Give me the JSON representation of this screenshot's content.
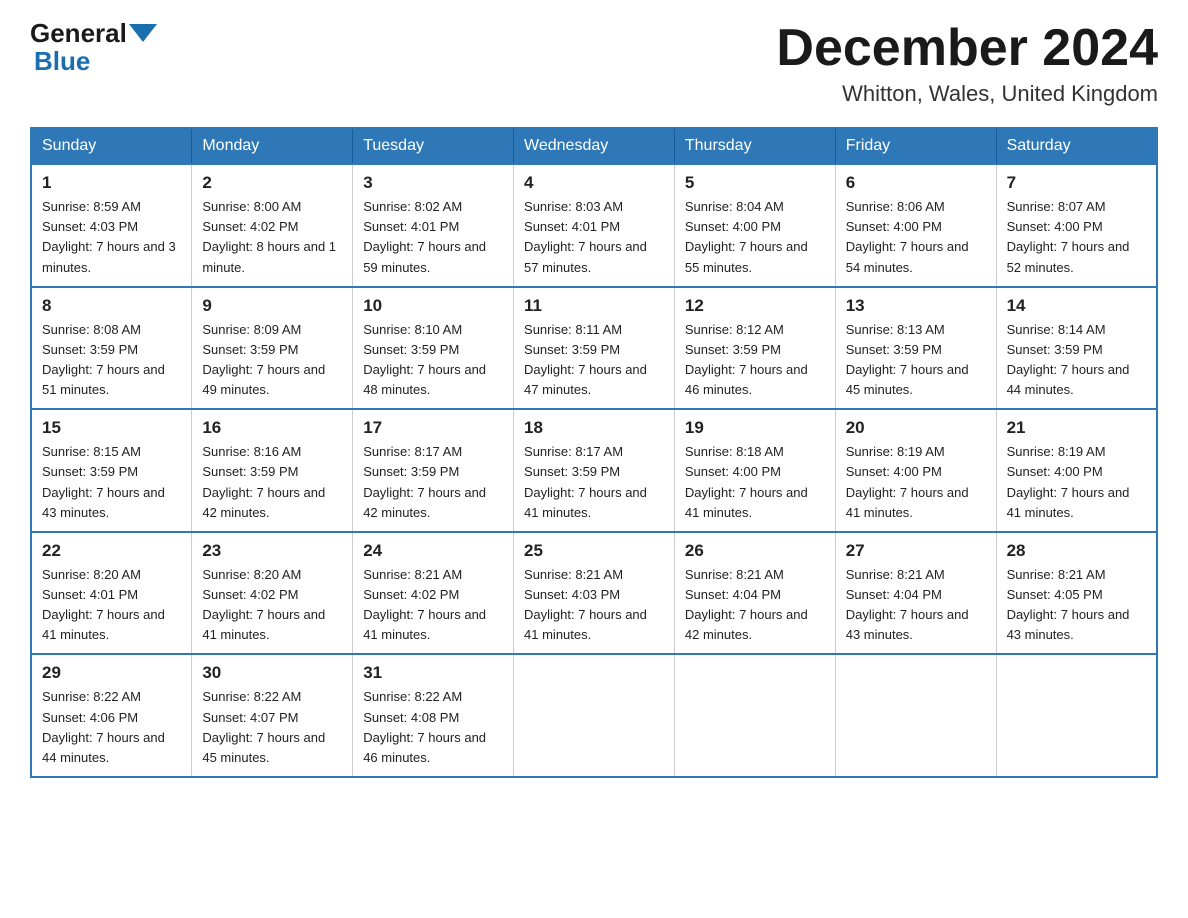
{
  "header": {
    "logo_text1": "General",
    "logo_text2": "Blue",
    "month": "December 2024",
    "location": "Whitton, Wales, United Kingdom"
  },
  "weekdays": [
    "Sunday",
    "Monday",
    "Tuesday",
    "Wednesday",
    "Thursday",
    "Friday",
    "Saturday"
  ],
  "weeks": [
    [
      {
        "day": "1",
        "sunrise": "8:59 AM",
        "sunset": "4:03 PM",
        "daylight": "7 hours and 3 minutes."
      },
      {
        "day": "2",
        "sunrise": "8:00 AM",
        "sunset": "4:02 PM",
        "daylight": "8 hours and 1 minute."
      },
      {
        "day": "3",
        "sunrise": "8:02 AM",
        "sunset": "4:01 PM",
        "daylight": "7 hours and 59 minutes."
      },
      {
        "day": "4",
        "sunrise": "8:03 AM",
        "sunset": "4:01 PM",
        "daylight": "7 hours and 57 minutes."
      },
      {
        "day": "5",
        "sunrise": "8:04 AM",
        "sunset": "4:00 PM",
        "daylight": "7 hours and 55 minutes."
      },
      {
        "day": "6",
        "sunrise": "8:06 AM",
        "sunset": "4:00 PM",
        "daylight": "7 hours and 54 minutes."
      },
      {
        "day": "7",
        "sunrise": "8:07 AM",
        "sunset": "4:00 PM",
        "daylight": "7 hours and 52 minutes."
      }
    ],
    [
      {
        "day": "8",
        "sunrise": "8:08 AM",
        "sunset": "3:59 PM",
        "daylight": "7 hours and 51 minutes."
      },
      {
        "day": "9",
        "sunrise": "8:09 AM",
        "sunset": "3:59 PM",
        "daylight": "7 hours and 49 minutes."
      },
      {
        "day": "10",
        "sunrise": "8:10 AM",
        "sunset": "3:59 PM",
        "daylight": "7 hours and 48 minutes."
      },
      {
        "day": "11",
        "sunrise": "8:11 AM",
        "sunset": "3:59 PM",
        "daylight": "7 hours and 47 minutes."
      },
      {
        "day": "12",
        "sunrise": "8:12 AM",
        "sunset": "3:59 PM",
        "daylight": "7 hours and 46 minutes."
      },
      {
        "day": "13",
        "sunrise": "8:13 AM",
        "sunset": "3:59 PM",
        "daylight": "7 hours and 45 minutes."
      },
      {
        "day": "14",
        "sunrise": "8:14 AM",
        "sunset": "3:59 PM",
        "daylight": "7 hours and 44 minutes."
      }
    ],
    [
      {
        "day": "15",
        "sunrise": "8:15 AM",
        "sunset": "3:59 PM",
        "daylight": "7 hours and 43 minutes."
      },
      {
        "day": "16",
        "sunrise": "8:16 AM",
        "sunset": "3:59 PM",
        "daylight": "7 hours and 42 minutes."
      },
      {
        "day": "17",
        "sunrise": "8:17 AM",
        "sunset": "3:59 PM",
        "daylight": "7 hours and 42 minutes."
      },
      {
        "day": "18",
        "sunrise": "8:17 AM",
        "sunset": "3:59 PM",
        "daylight": "7 hours and 41 minutes."
      },
      {
        "day": "19",
        "sunrise": "8:18 AM",
        "sunset": "4:00 PM",
        "daylight": "7 hours and 41 minutes."
      },
      {
        "day": "20",
        "sunrise": "8:19 AM",
        "sunset": "4:00 PM",
        "daylight": "7 hours and 41 minutes."
      },
      {
        "day": "21",
        "sunrise": "8:19 AM",
        "sunset": "4:00 PM",
        "daylight": "7 hours and 41 minutes."
      }
    ],
    [
      {
        "day": "22",
        "sunrise": "8:20 AM",
        "sunset": "4:01 PM",
        "daylight": "7 hours and 41 minutes."
      },
      {
        "day": "23",
        "sunrise": "8:20 AM",
        "sunset": "4:02 PM",
        "daylight": "7 hours and 41 minutes."
      },
      {
        "day": "24",
        "sunrise": "8:21 AM",
        "sunset": "4:02 PM",
        "daylight": "7 hours and 41 minutes."
      },
      {
        "day": "25",
        "sunrise": "8:21 AM",
        "sunset": "4:03 PM",
        "daylight": "7 hours and 41 minutes."
      },
      {
        "day": "26",
        "sunrise": "8:21 AM",
        "sunset": "4:04 PM",
        "daylight": "7 hours and 42 minutes."
      },
      {
        "day": "27",
        "sunrise": "8:21 AM",
        "sunset": "4:04 PM",
        "daylight": "7 hours and 43 minutes."
      },
      {
        "day": "28",
        "sunrise": "8:21 AM",
        "sunset": "4:05 PM",
        "daylight": "7 hours and 43 minutes."
      }
    ],
    [
      {
        "day": "29",
        "sunrise": "8:22 AM",
        "sunset": "4:06 PM",
        "daylight": "7 hours and 44 minutes."
      },
      {
        "day": "30",
        "sunrise": "8:22 AM",
        "sunset": "4:07 PM",
        "daylight": "7 hours and 45 minutes."
      },
      {
        "day": "31",
        "sunrise": "8:22 AM",
        "sunset": "4:08 PM",
        "daylight": "7 hours and 46 minutes."
      },
      null,
      null,
      null,
      null
    ]
  ]
}
